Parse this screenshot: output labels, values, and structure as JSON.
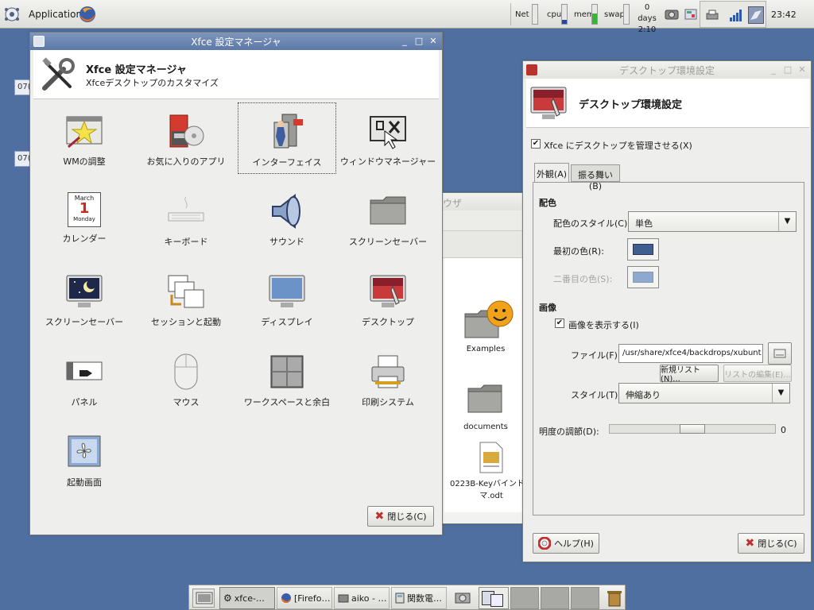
{
  "top_panel": {
    "applications_label": "Applications",
    "net_label": "Net",
    "cpu_label": "cpu",
    "mem_label": "mem",
    "swap_label": "swap",
    "uptime_days": "0 days",
    "uptime_time": "2:10",
    "clock": "23:42"
  },
  "desktop": {
    "side_label_1": "07(",
    "side_label_2": "07("
  },
  "settings_manager": {
    "title": "Xfce 設定マネージャ",
    "header_title": "Xfce 設定マネージャ",
    "header_subtitle": "Xfceデスクトップのカスタマイズ",
    "items": [
      {
        "label": "WMの調整",
        "icon": "wm-tweaks-icon"
      },
      {
        "label": "お気に入りのアプリ",
        "icon": "preferred-apps-icon"
      },
      {
        "label": "インターフェイス",
        "icon": "interface-icon"
      },
      {
        "label": "ウィンドウマネージャー",
        "icon": "window-manager-icon"
      },
      {
        "label": "カレンダー",
        "icon": "calendar-icon"
      },
      {
        "label": "キーボード",
        "icon": "keyboard-icon"
      },
      {
        "label": "サウンド",
        "icon": "sound-icon"
      },
      {
        "label": "スクリーンセーバー",
        "icon": "screensaver-icon"
      },
      {
        "label": "スクリーンセーバー",
        "icon": "screensaver-monitor-icon"
      },
      {
        "label": "セッションと起動",
        "icon": "session-icon"
      },
      {
        "label": "ディスプレイ",
        "icon": "display-icon"
      },
      {
        "label": "デスクトップ",
        "icon": "desktop-icon"
      },
      {
        "label": "パネル",
        "icon": "panel-icon"
      },
      {
        "label": "マウス",
        "icon": "mouse-icon"
      },
      {
        "label": "ワークスペースと余白",
        "icon": "workspaces-icon"
      },
      {
        "label": "印刷システム",
        "icon": "printer-icon"
      },
      {
        "label": "起動画面",
        "icon": "splash-icon"
      }
    ],
    "calendar_month": "March",
    "calendar_day": "1",
    "calendar_weekday": "Monday",
    "close_button": "閉じる(C)"
  },
  "file_browser": {
    "title_fragment": "ウザ",
    "files": [
      {
        "label": "Examples"
      },
      {
        "label": "documents"
      },
      {
        "label": "0223B-Keyバインドデ",
        "label2": "マ.odt"
      }
    ]
  },
  "desktop_settings": {
    "title": "デスクトップ環境設定",
    "header_title": "デスクトップ環境設定",
    "manage_desktop_label": "Xfce にデスクトップを管理させる(X)",
    "tabs": [
      {
        "label": "外観(A)",
        "active": true
      },
      {
        "label": "振る舞い(B)",
        "active": false
      }
    ],
    "color_section": "配色",
    "color_style_label": "配色のスタイル(C):",
    "color_style_value": "単色",
    "first_color_label": "最初の色(R):",
    "second_color_label": "二番目の色(S):",
    "first_color": "#3d5f92",
    "second_color": "#8ea9cf",
    "image_section": "画像",
    "show_image_label": "画像を表示する(I)",
    "file_label": "ファイル(F):",
    "file_value": "/usr/share/xfce4/backdrops/xubunt",
    "new_list_button": "新規リスト(N)...",
    "edit_list_button": "リストの編集(E)...",
    "style_label": "スタイル(T):",
    "style_value": "伸縮あり",
    "brightness_label": "明度の調節(D):",
    "brightness_value": "0",
    "help_button": "ヘルプ(H)",
    "close_button": "閉じる(C)"
  },
  "taskbar": {
    "tasks": [
      {
        "label": "xfce-…",
        "active": true
      },
      {
        "label": "[Firefo…",
        "active": false
      },
      {
        "label": "aiko - …",
        "active": false
      },
      {
        "label": "関数電…",
        "active": false
      }
    ]
  },
  "colors": {
    "desktop_bg": "#4f6fa1",
    "titlebar_active": "#5c79a8"
  }
}
